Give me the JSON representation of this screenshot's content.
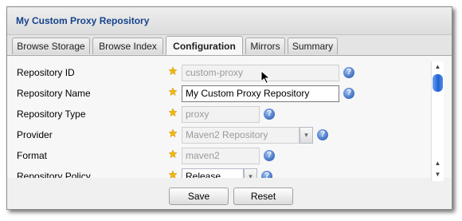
{
  "panel": {
    "title": "My Custom Proxy Repository"
  },
  "tabs": [
    {
      "label": "Browse Storage",
      "active": false
    },
    {
      "label": "Browse Index",
      "active": false
    },
    {
      "label": "Configuration",
      "active": true
    },
    {
      "label": "Mirrors",
      "active": false
    },
    {
      "label": "Summary",
      "active": false
    }
  ],
  "form": {
    "repository_id": {
      "label": "Repository ID",
      "value": "custom-proxy",
      "disabled": true
    },
    "repository_name": {
      "label": "Repository Name",
      "value": "My Custom Proxy Repository",
      "disabled": false
    },
    "repository_type": {
      "label": "Repository Type",
      "value": "proxy",
      "disabled": true
    },
    "provider": {
      "label": "Provider",
      "value": "Maven2 Repository",
      "disabled": true
    },
    "format": {
      "label": "Format",
      "value": "maven2",
      "disabled": true
    },
    "repository_policy": {
      "label": "Repository Policy",
      "value": "Release",
      "disabled": false
    }
  },
  "buttons": {
    "save": "Save",
    "reset": "Reset"
  },
  "icons": {
    "required": "star-icon",
    "help": "help-icon",
    "help_glyph": "?",
    "dropdown": "chevron-down-icon",
    "dropdown_glyph": "▾",
    "scroll_up_glyph": "▲",
    "scroll_down_glyph": "▼"
  },
  "colors": {
    "title": "#15428b",
    "help": "#3f6fc2",
    "star": "#f5b800",
    "scroll_thumb": "#1f61d6"
  }
}
